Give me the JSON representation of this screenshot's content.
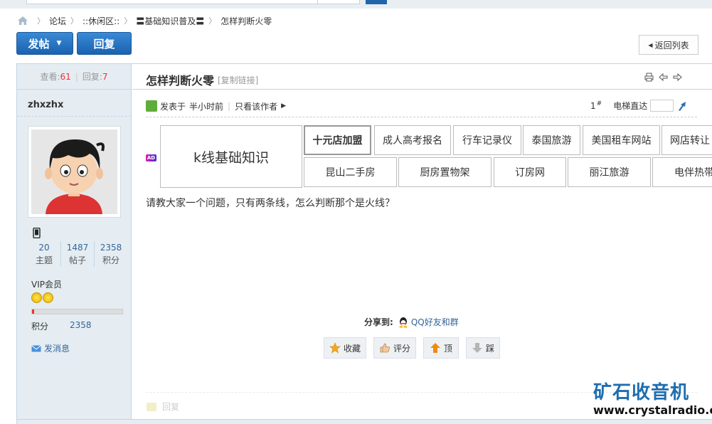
{
  "breadcrumb": {
    "items": [
      "论坛",
      "::休闲区::",
      "〓基础知识普及〓",
      "怎样判断火零"
    ]
  },
  "toolbar": {
    "post_label": "发帖",
    "reply_label": "回复",
    "back_label": "返回列表"
  },
  "sidebar": {
    "views_label": "查看:",
    "views": "61",
    "replies_label": "回复:",
    "replies": "7",
    "username": "zhxzhx",
    "stats": [
      {
        "value": "20",
        "label": "主题"
      },
      {
        "value": "1487",
        "label": "帖子"
      },
      {
        "value": "2358",
        "label": "积分"
      }
    ],
    "group": "VIP会员",
    "credit_label": "积分",
    "credit_value": "2358",
    "message_label": "发消息",
    "progress": 0.02
  },
  "post": {
    "title": "怎样判断火零",
    "copy_link": "[复制链接]",
    "posted_label": "发表于",
    "posted_time": "半小时前",
    "author_only": "只看该作者",
    "floor": "1",
    "floor_mark": "#",
    "jump_label": "电梯直达",
    "content": "请教大家一个问题，只有两条线，怎么判断那个是火线？"
  },
  "ad": {
    "badge": "AD",
    "main": "k线基础知识",
    "row1": [
      "十元店加盟",
      "成人高考报名",
      "行车记录仪",
      "泰国旅游",
      "美国租车网站",
      "网店转让"
    ],
    "row2": [
      "昆山二手房",
      "厨房置物架",
      "订房网",
      "丽江旅游",
      "电伴热带"
    ]
  },
  "share": {
    "label": "分享到:",
    "target": "QQ好友和群"
  },
  "actions": {
    "favorite": "收藏",
    "rate": "评分",
    "up": "顶",
    "down": "踩"
  },
  "footer": {
    "reply": "回复"
  },
  "watermark": {
    "name": "矿石收音机",
    "url": "www.crystalradio.cn"
  }
}
